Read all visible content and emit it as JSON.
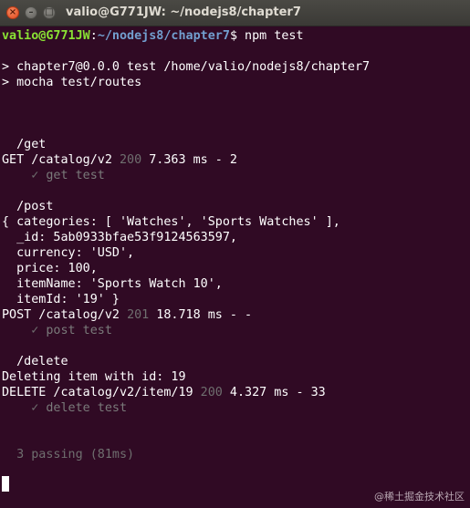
{
  "window": {
    "title": "valio@G771JW: ~/nodejs8/chapter7",
    "buttons": {
      "close": "×",
      "minimize": "–",
      "maximize": "□"
    }
  },
  "colors": {
    "background": "#300a24",
    "prompt_user": "#8ae234",
    "prompt_path": "#729fcf",
    "muted": "#6f6f6f"
  },
  "prompt": {
    "user_host": "valio@G771JW",
    "separator": ":",
    "path": "~/nodejs8/chapter7",
    "symbol": "$",
    "command": " npm test"
  },
  "header_lines": [
    "> chapter7@0.0.0 test /home/valio/nodejs8/chapter7",
    "> mocha test/routes"
  ],
  "get_section": {
    "title": "  /get",
    "request_prefix": "GET /catalog/v2 ",
    "status": "200",
    "request_suffix": " 7.363 ms - 2",
    "check": "    ✓",
    "test_name": " get test"
  },
  "post_section": {
    "title": "  /post",
    "body_lines": [
      "{ categories: [ 'Watches', 'Sports Watches' ],",
      "  _id: 5ab0933bfae53f9124563597,",
      "  currency: 'USD',",
      "  price: 100,",
      "  itemName: 'Sports Watch 10',",
      "  itemId: '19' }"
    ],
    "request_prefix": "POST /catalog/v2 ",
    "status": "201",
    "request_suffix": " 18.718 ms - -",
    "check": "    ✓",
    "test_name": " post test"
  },
  "delete_section": {
    "title": "  /delete",
    "log": "Deleting item with id: 19",
    "request_prefix": "DELETE /catalog/v2/item/19 ",
    "status": "200",
    "request_suffix": " 4.327 ms - 33",
    "check": "    ✓",
    "test_name": " delete test"
  },
  "summary": "  3 passing (81ms)",
  "watermark": "@稀土掘金技术社区"
}
